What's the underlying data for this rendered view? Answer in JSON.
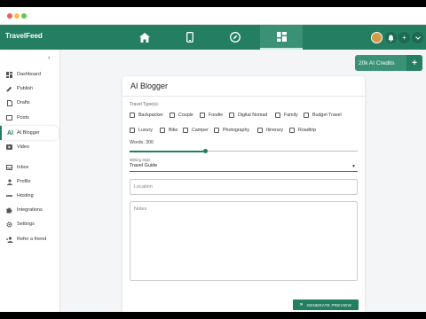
{
  "app": {
    "brand": "TravelFeed"
  },
  "window": {
    "dots": [
      "#ee5f57",
      "#f5bd4f",
      "#62c655"
    ]
  },
  "colors": {
    "primary": "#237e62",
    "primary_light": "#3a9176"
  },
  "topnav": {
    "icons": [
      "home-icon",
      "mobile-icon",
      "compass-icon",
      "dashboard-icon"
    ],
    "active": "dashboard-icon",
    "right_icons": [
      "avatar",
      "bell-icon",
      "plus-icon",
      "chevron-down-icon"
    ]
  },
  "sidebar": {
    "items": [
      {
        "label": "Dashboard",
        "icon": "dashboard-icon"
      },
      {
        "label": "Publish",
        "icon": "pencil-icon"
      },
      {
        "label": "Drafts",
        "icon": "drafts-icon"
      },
      {
        "label": "Posts",
        "icon": "posts-icon"
      },
      {
        "label": "AI Blogger",
        "icon": "ai-icon",
        "icon_text": "AI",
        "active": true
      },
      {
        "label": "Video",
        "icon": "video-icon"
      },
      {
        "label": "Inbox",
        "icon": "inbox-icon"
      },
      {
        "label": "Profile",
        "icon": "profile-icon"
      },
      {
        "label": "Hosting",
        "icon": "hosting-icon"
      },
      {
        "label": "Integrations",
        "icon": "puzzle-icon"
      },
      {
        "label": "Settings",
        "icon": "gear-icon"
      },
      {
        "label": "Refer a friend",
        "icon": "add-person-icon"
      }
    ]
  },
  "credits": {
    "label": "20k AI Credits",
    "plus": "+"
  },
  "form": {
    "title": "AI Blogger",
    "travel_types_label": "Travel Type(s):",
    "travel_types": [
      "Backpacker",
      "Couple",
      "Foodie",
      "Digital Nomad",
      "Family",
      "Budget Travel",
      "Luxury",
      "Bike",
      "Camper",
      "Photography",
      "Itinerary",
      "Roadtrip"
    ],
    "words_label": "Words: 300",
    "words_fraction": 0.33,
    "writing_style_label": "Writing Style",
    "writing_style_value": "Travel Guide",
    "location_placeholder": "Location",
    "notes_placeholder": "Notes",
    "generate_button": "GENERATE PREVIEW"
  }
}
